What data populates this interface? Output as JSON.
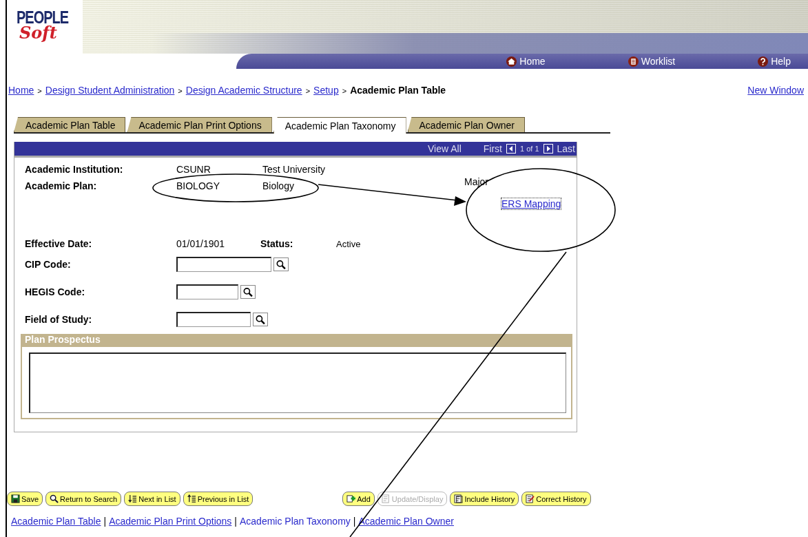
{
  "logo": {
    "upper": "PEOPLE",
    "lower": "Soft"
  },
  "nav": [
    {
      "label": "Home"
    },
    {
      "label": "Worklist"
    },
    {
      "label": "Help"
    }
  ],
  "breadcrumb": [
    {
      "kind": "link",
      "label": "Home"
    },
    {
      "kind": "separator",
      "label": ">"
    },
    {
      "kind": "link",
      "label": "Design Student Administration"
    },
    {
      "kind": "separator",
      "label": ">"
    },
    {
      "kind": "link",
      "label": "Design Academic Structure"
    },
    {
      "kind": "separator",
      "label": ">"
    },
    {
      "kind": "link",
      "label": "Setup"
    },
    {
      "kind": "separator",
      "label": ">"
    },
    {
      "kind": "current",
      "label": "Academic Plan Table"
    }
  ],
  "new_window": "New Window",
  "tabs": [
    {
      "label": "Academic Plan Table",
      "selected": false
    },
    {
      "label": "Academic Plan Print Options",
      "selected": false
    },
    {
      "label": "Academic Plan Taxonomy",
      "selected": true
    },
    {
      "label": "Academic Plan Owner",
      "selected": false
    }
  ],
  "grid_header": {
    "view_all": "View All",
    "first": "First",
    "position": "1 of 1",
    "last": "Last"
  },
  "institution": {
    "label": "Academic Institution:",
    "code": "CSUNR",
    "description": "Test University"
  },
  "plan": {
    "label": "Academic Plan:",
    "code": "BIOLOGY",
    "description": "Biology",
    "type": "Major",
    "link": "ERS Mapping"
  },
  "effective_date": {
    "label": "Effective Date:",
    "value": "01/01/1901"
  },
  "status": {
    "label": "Status:",
    "value": "Active"
  },
  "lookups": [
    {
      "label": "CIP Code:"
    },
    {
      "label": "HEGIS Code:"
    },
    {
      "label": "Field of Study:"
    }
  ],
  "prospectus": {
    "title": "Plan Prospectus"
  },
  "buttons_left": [
    {
      "label": "Save",
      "disabled": false
    },
    {
      "label": "Return to Search",
      "disabled": false
    },
    {
      "label": "Next in List",
      "disabled": false
    },
    {
      "label": "Previous in List",
      "disabled": false
    }
  ],
  "buttons_right": [
    {
      "label": "Add",
      "disabled": false
    },
    {
      "label": "Update/Display",
      "disabled": true
    },
    {
      "label": "Include History",
      "disabled": false
    },
    {
      "label": "Correct History",
      "disabled": false
    }
  ],
  "footer": [
    {
      "kind": "link",
      "label": "Academic Plan Table",
      "selected": false
    },
    {
      "kind": "separator",
      "label": "|"
    },
    {
      "kind": "link",
      "label": "Academic Plan Print Options",
      "selected": false
    },
    {
      "kind": "separator",
      "label": "|"
    },
    {
      "kind": "link",
      "label": "Academic Plan Taxonomy",
      "selected": true
    },
    {
      "kind": "separator",
      "label": "|"
    },
    {
      "kind": "link",
      "label": "Academic Plan Owner",
      "selected": false
    }
  ]
}
